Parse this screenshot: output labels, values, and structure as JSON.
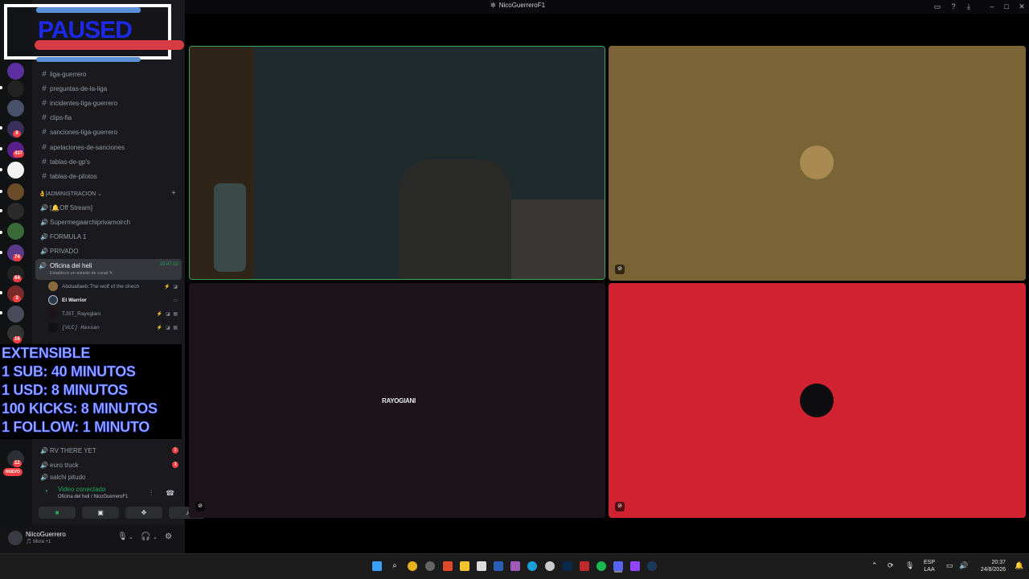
{
  "window": {
    "title": "NicoGuerreroF1"
  },
  "overlay": {
    "paused": "PAUSED",
    "promo_lines": [
      "EXTENSIBLE",
      "1 SUB: 40 MINUTOS",
      "1 USD: 8 MINUTOS",
      "100 KICKS: 8 MINUTOS",
      "1 FOLLOW: 1 MINUTO"
    ]
  },
  "rail": {
    "badges": [
      "10",
      "8",
      "437",
      "74",
      "64",
      "3",
      "16",
      "12"
    ],
    "new_label": "NUEVO"
  },
  "sidebar": {
    "text_channels": [
      "liga-guerrero",
      "preguntas-de-la-liga",
      "incidentes-liga-guerrero",
      "clips-fia",
      "sanciones-liga-guerrero",
      "apelaciones-de-sanciones",
      "tablas-de-gp's",
      "tablas-de-pilotos"
    ],
    "category_admin": "ADMINISTRACION",
    "voice_channels": [
      "[🔔Off Stream]",
      "Supermegaarchiprivamoirch",
      "FORMULA 1",
      "PRIVADO"
    ],
    "active_channel": {
      "name": "Oficina del heli",
      "time": "10:47:02",
      "status": "Establece un estado de canal ✎"
    },
    "members": [
      {
        "name": "Abduallaeb:The wolf of the chech",
        "icons": "⚡ ◪"
      },
      {
        "name": "El Warrior",
        "icons": "▭"
      },
      {
        "name": "TJST_Rayogiani",
        "icons": "⚡ ◪ ▦"
      },
      {
        "name": "[VLC] Hassan",
        "icons": "⚡ ◪ ▦"
      }
    ],
    "lower_channels": [
      {
        "name": "RV THERE YET",
        "badge": "1"
      },
      {
        "name": "euro truck",
        "badge": "3"
      },
      {
        "name": "salchi pitudo",
        "badge": ""
      }
    ]
  },
  "voice_panel": {
    "status": "Video conectado",
    "channel": "Oficina del heli / NicoGuerreroF1"
  },
  "user_panel": {
    "name": "NiicoGuerrero",
    "status": "🎵 Mora +1"
  },
  "tiles": {
    "rayo_label": "RAYOGIANI"
  },
  "taskbar": {
    "lang_top": "ESP",
    "lang_bottom": "LAA",
    "time": "20:37",
    "date": "24/8/2026"
  }
}
